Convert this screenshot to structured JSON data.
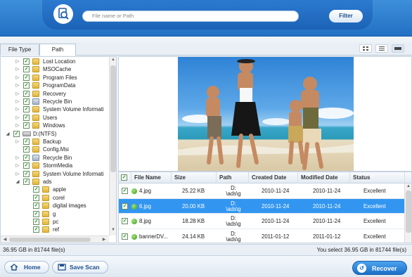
{
  "search": {
    "placeholder": "File name or Path",
    "filter_label": "Filter"
  },
  "tabs": [
    {
      "label": "File Type"
    },
    {
      "label": "Path"
    }
  ],
  "tree": [
    {
      "label": "Lost Location",
      "level": 2,
      "icon": "folder-icon",
      "expander": "right",
      "checked": true
    },
    {
      "label": "MSOCache",
      "level": 2,
      "icon": "folder-icon",
      "expander": "right",
      "checked": true
    },
    {
      "label": "Program Files",
      "level": 2,
      "icon": "folder-icon",
      "expander": "right",
      "checked": true
    },
    {
      "label": "ProgramData",
      "level": 2,
      "icon": "folder-icon",
      "expander": "right",
      "checked": true
    },
    {
      "label": "Recovery",
      "level": 2,
      "icon": "folder-icon",
      "expander": "right",
      "checked": true
    },
    {
      "label": "Recycle Bin",
      "level": 2,
      "icon": "recycle-bin-icon",
      "expander": "right",
      "checked": true
    },
    {
      "label": "System Volume Informati",
      "level": 2,
      "icon": "folder-icon",
      "expander": "right",
      "checked": true
    },
    {
      "label": "Users",
      "level": 2,
      "icon": "folder-icon",
      "expander": "right",
      "checked": true
    },
    {
      "label": "Windows",
      "level": 2,
      "icon": "folder-icon",
      "expander": "right",
      "checked": true
    },
    {
      "label": "D:(NTFS)",
      "level": 1,
      "icon": "drive-icon",
      "expander": "down",
      "checked": true
    },
    {
      "label": "Backup",
      "level": 2,
      "icon": "folder-icon",
      "expander": "right",
      "checked": true
    },
    {
      "label": "Config.Msi",
      "level": 2,
      "icon": "folder-icon",
      "expander": "",
      "checked": true
    },
    {
      "label": "Recycle Bin",
      "level": 2,
      "icon": "recycle-bin-icon",
      "expander": "right",
      "checked": true
    },
    {
      "label": "StormMedia",
      "level": 2,
      "icon": "folder-icon",
      "expander": "right",
      "checked": true
    },
    {
      "label": "System Volume Informati",
      "level": 2,
      "icon": "folder-icon",
      "expander": "right",
      "checked": true
    },
    {
      "label": "ads",
      "level": 2,
      "icon": "folder-icon",
      "expander": "down",
      "checked": true
    },
    {
      "label": "apple",
      "level": 3,
      "icon": "folder-icon",
      "expander": "",
      "checked": true
    },
    {
      "label": "corel",
      "level": 3,
      "icon": "folder-icon",
      "expander": "",
      "checked": true
    },
    {
      "label": "digital images",
      "level": 3,
      "icon": "folder-icon",
      "expander": "",
      "checked": true
    },
    {
      "label": "g",
      "level": 3,
      "icon": "folder-icon",
      "expander": "",
      "checked": true
    },
    {
      "label": "pc",
      "level": 3,
      "icon": "folder-icon",
      "expander": "",
      "checked": true
    },
    {
      "label": "ref",
      "level": 3,
      "icon": "folder-icon",
      "expander": "",
      "checked": true
    }
  ],
  "table": {
    "headers": [
      "File Name",
      "Size",
      "Path",
      "Created Date",
      "Modified Date",
      "Status"
    ],
    "rows": [
      {
        "name": "4.jpg",
        "size": "25.22 KB",
        "path1": "D:",
        "path2": "\\ads\\g",
        "created": "2010-11-24",
        "modified": "2010-11-24",
        "status": "Excellent",
        "selected": false
      },
      {
        "name": "6.jpg",
        "size": "20.00 KB",
        "path1": "D:",
        "path2": "\\ads\\g",
        "created": "2010-11-24",
        "modified": "2010-11-24",
        "status": "Excellent",
        "selected": true
      },
      {
        "name": "8.jpg",
        "size": "18.28 KB",
        "path1": "D:",
        "path2": "\\ads\\g",
        "created": "2010-11-24",
        "modified": "2010-11-24",
        "status": "Excellent",
        "selected": false
      },
      {
        "name": "bannerDV...",
        "size": "24.14 KB",
        "path1": "D:",
        "path2": "\\ads\\g",
        "created": "2011-01-12",
        "modified": "2011-01-12",
        "status": "Excellent",
        "selected": false
      }
    ]
  },
  "status": {
    "left": "36.95 GB in 81744 file(s)",
    "right": "You select 36.95 GB in 81744 file(s)"
  },
  "buttons": {
    "home": "Home",
    "save_scan": "Save Scan",
    "recover": "Recover"
  },
  "colors": {
    "accent": "#2270c4",
    "selection": "#3296f0",
    "status_ok": "#3f9e1c"
  }
}
